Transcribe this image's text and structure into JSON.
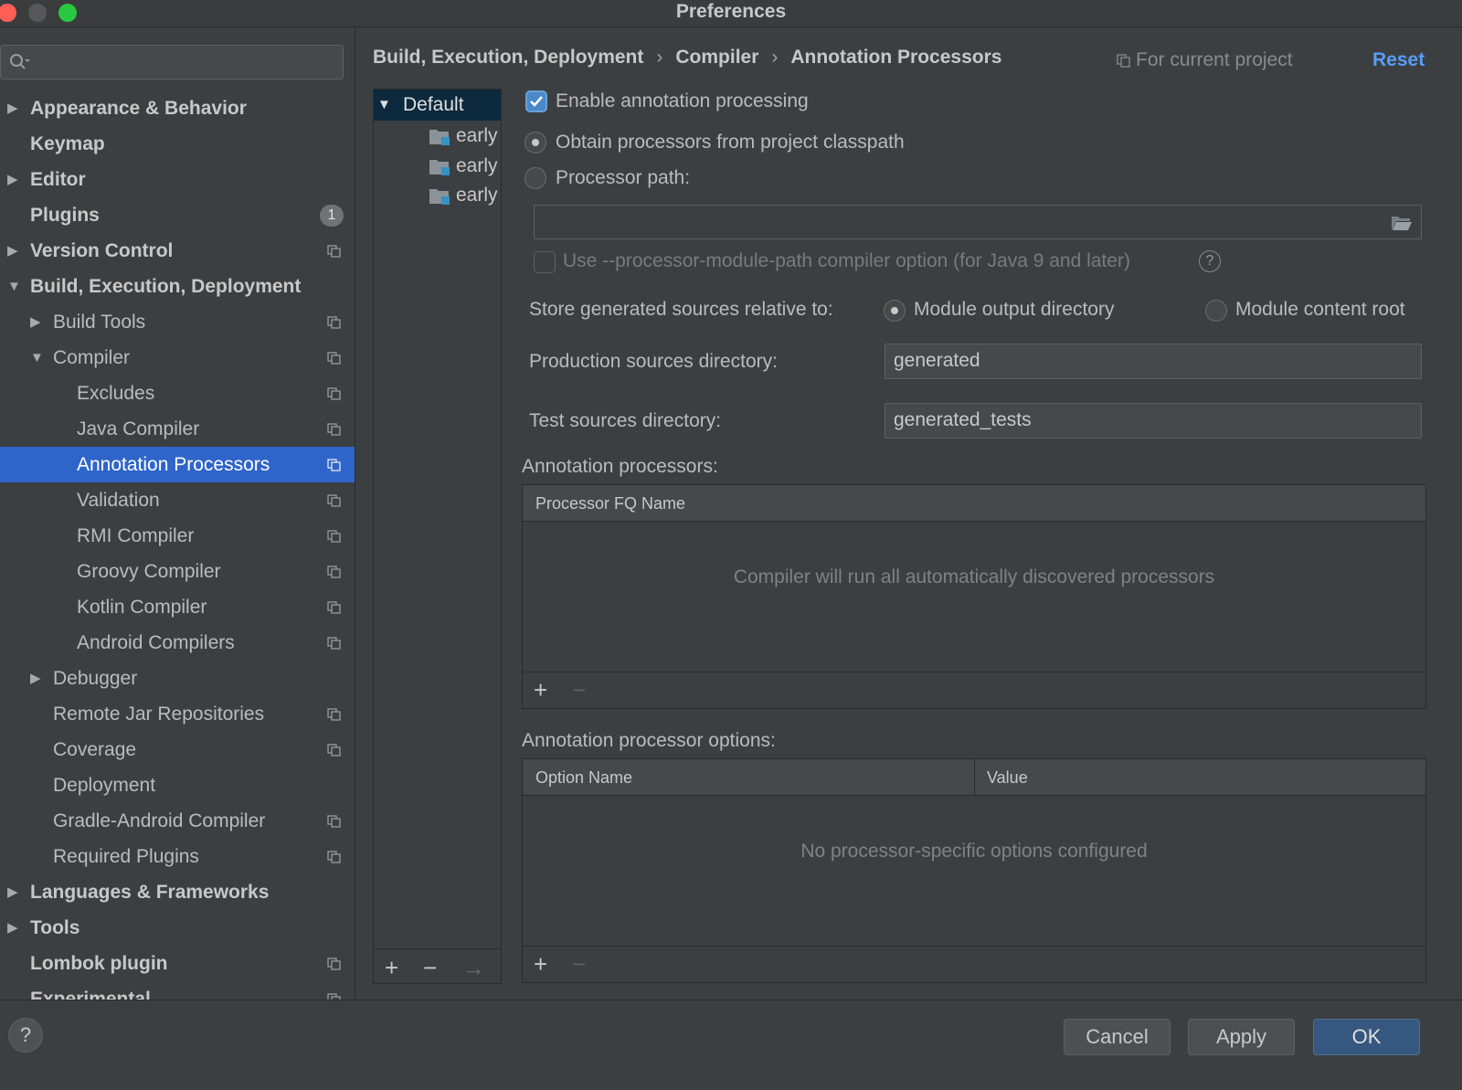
{
  "window": {
    "title": "Preferences"
  },
  "search": {
    "placeholder": ""
  },
  "sidebar": {
    "items": [
      {
        "label": "Appearance & Behavior",
        "arrow": "▶",
        "badge": ""
      },
      {
        "label": "Keymap",
        "arrow": "",
        "badge": ""
      },
      {
        "label": "Editor",
        "arrow": "▶",
        "badge": ""
      },
      {
        "label": "Plugins",
        "arrow": "",
        "badge": "1"
      },
      {
        "label": "Version Control",
        "arrow": "▶",
        "badge": ""
      },
      {
        "label": "Build, Execution, Deployment",
        "arrow": "▼",
        "badge": ""
      },
      {
        "label": "Build Tools",
        "arrow": "▶",
        "badge": ""
      },
      {
        "label": "Compiler",
        "arrow": "▼",
        "badge": ""
      },
      {
        "label": "Excludes",
        "arrow": "",
        "badge": ""
      },
      {
        "label": "Java Compiler",
        "arrow": "",
        "badge": ""
      },
      {
        "label": "Annotation Processors",
        "arrow": "",
        "badge": ""
      },
      {
        "label": "Validation",
        "arrow": "",
        "badge": ""
      },
      {
        "label": "RMI Compiler",
        "arrow": "",
        "badge": ""
      },
      {
        "label": "Groovy Compiler",
        "arrow": "",
        "badge": ""
      },
      {
        "label": "Kotlin Compiler",
        "arrow": "",
        "badge": ""
      },
      {
        "label": "Android Compilers",
        "arrow": "",
        "badge": ""
      },
      {
        "label": "Debugger",
        "arrow": "▶",
        "badge": ""
      },
      {
        "label": "Remote Jar Repositories",
        "arrow": "",
        "badge": ""
      },
      {
        "label": "Coverage",
        "arrow": "",
        "badge": ""
      },
      {
        "label": "Deployment",
        "arrow": "",
        "badge": ""
      },
      {
        "label": "Gradle-Android Compiler",
        "arrow": "",
        "badge": ""
      },
      {
        "label": "Required Plugins",
        "arrow": "",
        "badge": ""
      },
      {
        "label": "Languages & Frameworks",
        "arrow": "▶",
        "badge": ""
      },
      {
        "label": "Tools",
        "arrow": "▶",
        "badge": ""
      },
      {
        "label": "Lombok plugin",
        "arrow": "",
        "badge": ""
      },
      {
        "label": "Experimental",
        "arrow": "",
        "badge": ""
      }
    ]
  },
  "breadcrumb": {
    "items": [
      "Build, Execution, Deployment",
      "Compiler",
      "Annotation Processors"
    ],
    "separator": "›",
    "scope": "For current project",
    "reset": "Reset"
  },
  "profiles": {
    "default": {
      "label": "Default",
      "arrow": "▼"
    },
    "modules": [
      "early",
      "early",
      "early"
    ],
    "toolbar": {
      "add": "+",
      "remove": "−",
      "move": "→"
    }
  },
  "form": {
    "enable_processing": {
      "label": "Enable annotation processing",
      "checked": true
    },
    "obtain_classpath": {
      "label": "Obtain processors from project classpath",
      "selected": true
    },
    "processor_path": {
      "label": "Processor path:",
      "selected": false,
      "value": ""
    },
    "module_path_option": {
      "label": "Use --processor-module-path compiler option (for Java 9 and later)",
      "checked": false,
      "help": "?"
    },
    "store_generated": {
      "label": "Store generated sources relative to:",
      "option_output": "Module output directory",
      "option_content": "Module content root",
      "selected": "Module output directory"
    },
    "production_dir": {
      "label": "Production sources directory:",
      "value": "generated"
    },
    "test_dir": {
      "label": "Test sources directory:",
      "value": "generated_tests"
    },
    "processors_table": {
      "title": "Annotation processors:",
      "columns": [
        "Processor FQ Name"
      ],
      "empty_text": "Compiler will run all automatically discovered processors",
      "add": "+",
      "remove": "−"
    },
    "options_table": {
      "title": "Annotation processor options:",
      "columns": [
        "Option Name",
        "Value"
      ],
      "empty_text": "No processor-specific options configured",
      "add": "+",
      "remove": "−"
    }
  },
  "buttons": {
    "help": "?",
    "cancel": "Cancel",
    "apply": "Apply",
    "ok": "OK"
  },
  "colors": {
    "selection": "#2f65ca",
    "link": "#589df6",
    "primary_button": "#365880",
    "background": "#3c3f41"
  }
}
